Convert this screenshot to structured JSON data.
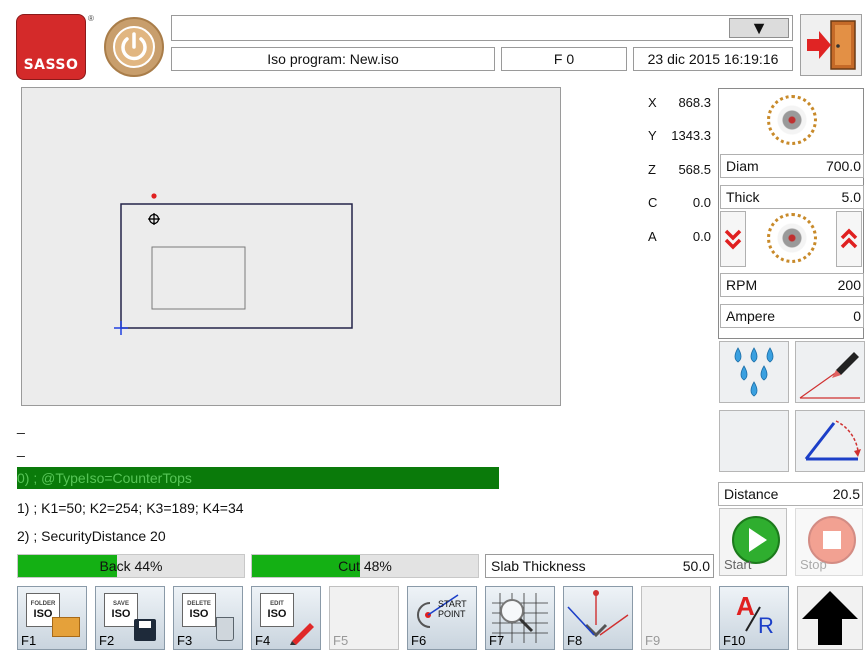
{
  "brand": {
    "logo_text": "SASSO",
    "trademark": "®"
  },
  "header": {
    "program_label": "Iso program: New.iso",
    "feed_label": "F 0",
    "datetime": "23 dic 2015 16:19:16",
    "combo_arrow": "▼"
  },
  "axes": [
    {
      "name": "X",
      "value": "868.3"
    },
    {
      "name": "Y",
      "value": "1343.3"
    },
    {
      "name": "Z",
      "value": "568.5"
    },
    {
      "name": "C",
      "value": "0.0"
    },
    {
      "name": "A",
      "value": "0.0"
    }
  ],
  "tool": {
    "diam_label": "Diam",
    "diam_value": "700.0",
    "thick_label": "Thick",
    "thick_value": "5.0",
    "rpm_label": "RPM",
    "rpm_value": "200",
    "ampere_label": "Ampere",
    "ampere_value": "0"
  },
  "distance": {
    "label": "Distance",
    "value": "20.5"
  },
  "code": {
    "line_dash_1": "_",
    "line_dash_2": "_",
    "highlight": "0) ; @TypeIso=CounterTops",
    "line_1": "1) ; K1=50; K2=254; K3=189; K4=34",
    "line_2": "2) ; SecurityDistance 20"
  },
  "progress": {
    "back": {
      "label": "Back 44%",
      "percent": 44
    },
    "cut": {
      "label": "Cut 48%",
      "percent": 48
    }
  },
  "slab": {
    "label": "Slab Thickness",
    "value": "50.0"
  },
  "actions": {
    "start_label": "Start",
    "stop_label": "Stop"
  },
  "fkeys": [
    {
      "label": "F1",
      "doc_top": "FOLDER",
      "doc_main": "ISO"
    },
    {
      "label": "F2",
      "doc_top": "SAVE",
      "doc_main": "ISO"
    },
    {
      "label": "F3",
      "doc_top": "DELETE",
      "doc_main": "ISO"
    },
    {
      "label": "F4",
      "doc_top": "EDIT",
      "doc_main": "ISO"
    },
    {
      "label": "F5"
    },
    {
      "label": "F6",
      "icon_text": "START POINT"
    },
    {
      "label": "F7"
    },
    {
      "label": "F8"
    },
    {
      "label": "F9"
    },
    {
      "label": "F10",
      "icon_a": "A",
      "icon_r": "R"
    }
  ],
  "colors": {
    "logo": "#d42a2a",
    "progress": "#14b014",
    "highlight": "#0a7a0a",
    "start": "#2fae2f",
    "stop": "#e8553a"
  }
}
